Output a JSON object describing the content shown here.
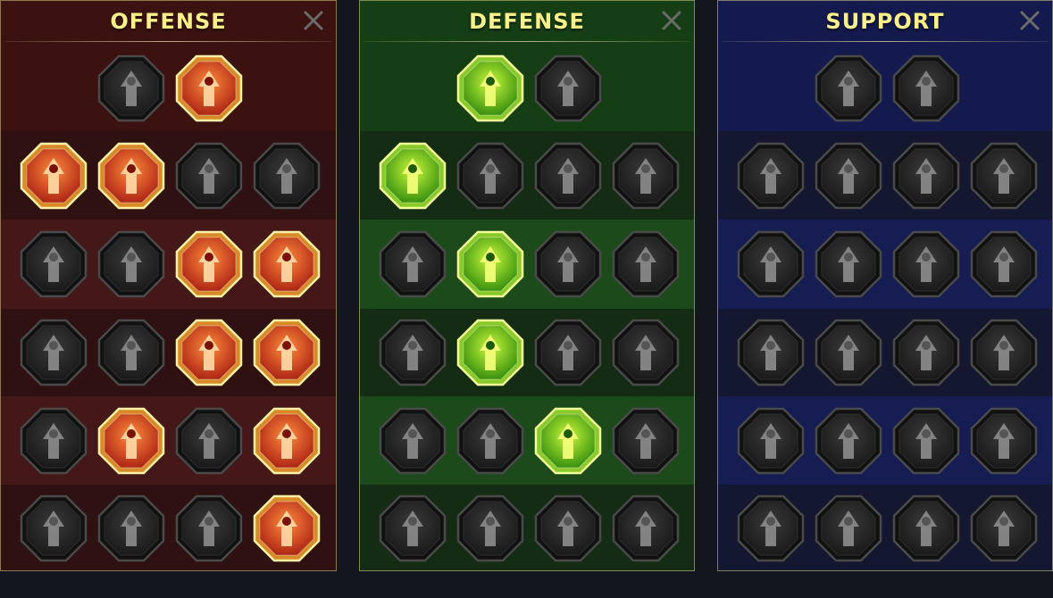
{
  "colors": {
    "title_text": "#fbf08a",
    "offense": {
      "tier0": "#3c1210",
      "band_a": "#2e1110",
      "band_b": "#441818"
    },
    "defense": {
      "tier0": "#163e15",
      "band_a": "#132c13",
      "band_b": "#1c4a1b"
    },
    "support": {
      "tier0": "#141a4d",
      "band_a": "#141730",
      "band_b": "#161d53"
    },
    "active_offense": "#e0451f",
    "active_defense": "#6cd11f",
    "inactive": "#252525"
  },
  "panels": [
    {
      "key": "offense",
      "title": "OFFENSE",
      "close_icon": "close-x-icon",
      "tiers": [
        [
          {
            "name": "crossed-swords-icon",
            "active": false
          },
          {
            "name": "flaming-sword-icon",
            "active": true
          }
        ],
        [
          {
            "name": "horned-demon-icon",
            "active": true
          },
          {
            "name": "sword-strikes-icon",
            "active": true
          },
          {
            "name": "shield-arrow-icon",
            "active": false
          },
          {
            "name": "pierced-heart-icon",
            "active": false
          }
        ],
        [
          {
            "name": "arrow-pierced-warrior-icon",
            "active": false
          },
          {
            "name": "fanged-jaws-icon",
            "active": false
          },
          {
            "name": "skull-slash-icon",
            "active": true
          },
          {
            "name": "scythe-hand-icon",
            "active": true
          }
        ],
        [
          {
            "name": "sword-heart-icon",
            "active": false
          },
          {
            "name": "gauntlet-fist-icon",
            "active": false
          },
          {
            "name": "crossed-axes-icon",
            "active": true
          },
          {
            "name": "lightning-chains-icon",
            "active": true
          }
        ],
        [
          {
            "name": "talon-claw-icon",
            "active": false
          },
          {
            "name": "triple-skulls-icon",
            "active": true
          },
          {
            "name": "dagger-circle-icon",
            "active": false
          },
          {
            "name": "enraged-figure-icon",
            "active": true
          }
        ],
        [
          {
            "name": "sparkling-sword-icon",
            "active": false
          },
          {
            "name": "knight-helmet-icon",
            "active": false
          },
          {
            "name": "horned-beast-icon",
            "active": false
          },
          {
            "name": "skull-sword-icon",
            "active": true
          }
        ]
      ]
    },
    {
      "key": "defense",
      "title": "DEFENSE",
      "close_icon": "close-x-icon",
      "tiers": [
        [
          {
            "name": "stacked-bricks-icon",
            "active": true
          },
          {
            "name": "raised-fist-icon",
            "active": false
          }
        ],
        [
          {
            "name": "chevron-shield-icon",
            "active": true
          },
          {
            "name": "broken-heart-icon",
            "active": false
          },
          {
            "name": "armored-torso-icon",
            "active": false
          },
          {
            "name": "crossed-blades-icon",
            "active": false
          }
        ],
        [
          {
            "name": "thorned-figure-icon",
            "active": false
          },
          {
            "name": "knight-shield-icon",
            "active": true
          },
          {
            "name": "shielded-skull-heart-icon",
            "active": false
          },
          {
            "name": "hooded-face-icon",
            "active": false
          }
        ],
        [
          {
            "name": "cheering-crowd-icon",
            "active": false
          },
          {
            "name": "skull-hourglass-icon",
            "active": true
          },
          {
            "name": "open-palm-icon",
            "active": false
          },
          {
            "name": "bull-head-icon",
            "active": false
          }
        ],
        [
          {
            "name": "dashing-runner-icon",
            "active": false
          },
          {
            "name": "blood-drops-icon",
            "active": false
          },
          {
            "name": "radiant-skull-icon",
            "active": true
          },
          {
            "name": "grasping-hand-icon",
            "active": false
          }
        ],
        [
          {
            "name": "spiked-warrior-icon",
            "active": false
          },
          {
            "name": "winged-shield-icon",
            "active": false
          },
          {
            "name": "bald-head-icon",
            "active": false
          },
          {
            "name": "flexing-body-icon",
            "active": false
          }
        ]
      ]
    },
    {
      "key": "support",
      "title": "SUPPORT",
      "close_icon": "close-x-icon",
      "tiers": [
        [
          {
            "name": "healing-heart-icon",
            "active": false
          },
          {
            "name": "shattered-ring-icon",
            "active": false
          }
        ],
        [
          {
            "name": "praying-hands-icon",
            "active": false
          },
          {
            "name": "shield-rings-icon",
            "active": false
          },
          {
            "name": "flaming-skull-icon",
            "active": false
          },
          {
            "name": "swift-boot-icon",
            "active": false
          }
        ],
        [
          {
            "name": "blessed-figure-icon",
            "active": false
          },
          {
            "name": "lightning-shield-icon",
            "active": false
          },
          {
            "name": "cracked-ground-icon",
            "active": false
          },
          {
            "name": "shadow-figures-icon",
            "active": false
          }
        ],
        [
          {
            "name": "chained-heart-icon",
            "active": false
          },
          {
            "name": "meteor-icon",
            "active": false
          },
          {
            "name": "open-book-icon",
            "active": false
          },
          {
            "name": "glaring-eyes-icon",
            "active": false
          }
        ],
        [
          {
            "name": "compass-star-icon",
            "active": false
          },
          {
            "name": "winged-boot-icon",
            "active": false
          },
          {
            "name": "all-seeing-eye-icon",
            "active": false
          },
          {
            "name": "poison-skull-icon",
            "active": false
          }
        ],
        [
          {
            "name": "potion-flask-icon",
            "active": false
          },
          {
            "name": "grinning-skull-icon",
            "active": false
          },
          {
            "name": "crushing-fist-icon",
            "active": false
          },
          {
            "name": "eagle-head-icon",
            "active": false
          }
        ]
      ]
    }
  ]
}
